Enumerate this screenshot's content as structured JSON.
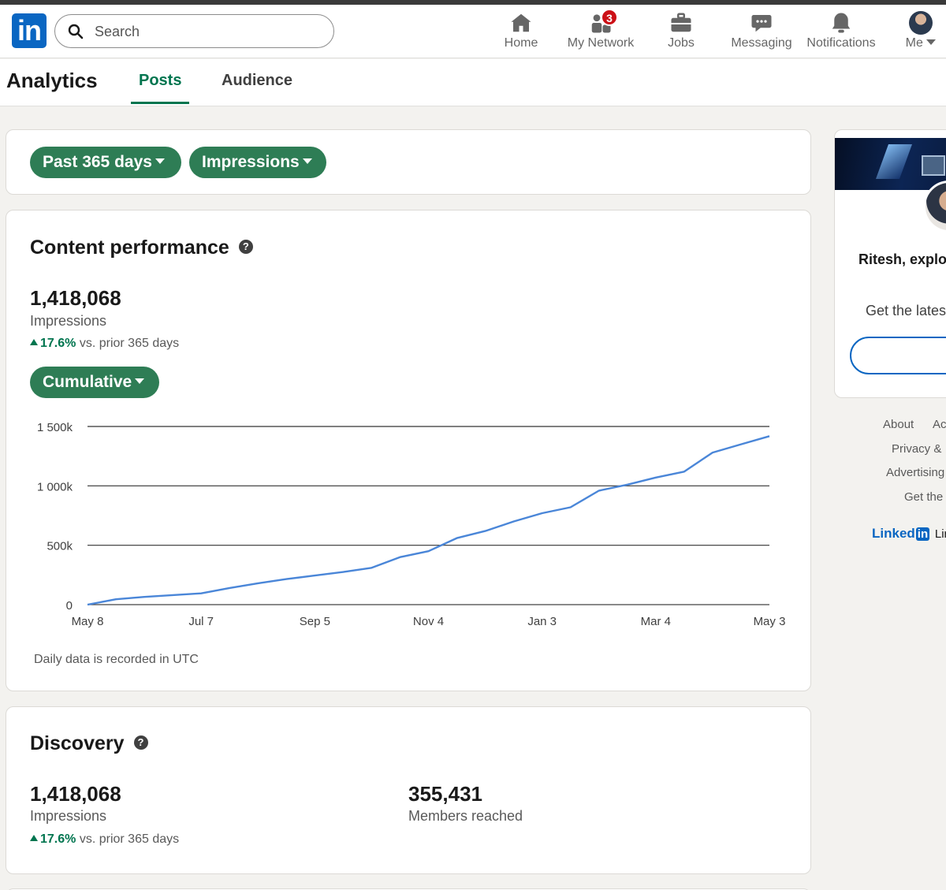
{
  "nav": {
    "logo_text": "in",
    "search_placeholder": "Search",
    "items": [
      {
        "label": "Home",
        "icon": "home-icon"
      },
      {
        "label": "My Network",
        "icon": "network-icon",
        "badge": "3"
      },
      {
        "label": "Jobs",
        "icon": "briefcase-icon"
      },
      {
        "label": "Messaging",
        "icon": "chat-icon"
      },
      {
        "label": "Notifications",
        "icon": "bell-icon"
      },
      {
        "label": "Me",
        "icon": "avatar"
      }
    ]
  },
  "subheader": {
    "title": "Analytics",
    "tabs": [
      {
        "label": "Posts",
        "active": true
      },
      {
        "label": "Audience",
        "active": false
      }
    ]
  },
  "filters": {
    "range_label": "Past 365 days",
    "metric_label": "Impressions"
  },
  "content_performance": {
    "title": "Content performance",
    "impressions_value": "1,418,068",
    "impressions_label": "Impressions",
    "trend_pct": "17.6%",
    "trend_text": "vs. prior 365 days",
    "mode_label": "Cumulative",
    "note": "Daily data is recorded in UTC"
  },
  "discovery": {
    "title": "Discovery",
    "impressions_value": "1,418,068",
    "impressions_label": "Impressions",
    "trend_pct": "17.6%",
    "trend_text": "vs. prior 365 days",
    "members_value": "355,431",
    "members_label": "Members reached"
  },
  "rail": {
    "name": "Ritesh, explo",
    "text": "Get the lates"
  },
  "footer": {
    "links": [
      "About",
      "Ac",
      "Privacy &",
      "Advertising",
      "Get the"
    ],
    "brand_word": "Linked",
    "brand_box": "in",
    "brand_tail": "Lir"
  },
  "colors": {
    "accent_green": "#2e7d55",
    "line_blue": "#4a86d8",
    "linkedin_blue": "#0a66c2",
    "badge_red": "#cc1016"
  },
  "chart_data": {
    "type": "line",
    "xlabel": "",
    "ylabel": "",
    "ylim": [
      0,
      1500000
    ],
    "y_ticks": [
      0,
      500000,
      1000000,
      1500000
    ],
    "y_tick_labels": [
      "0",
      "500k",
      "1 000k",
      "1 500k"
    ],
    "x_tick_labels": [
      "May 8",
      "Jul 7",
      "Sep 5",
      "Nov 4",
      "Jan 3",
      "Mar 4",
      "May 3"
    ],
    "grid": true,
    "series": [
      {
        "x": [
          "May 8",
          "May 23",
          "Jun 7",
          "Jun 22",
          "Jul 7",
          "Jul 22",
          "Aug 6",
          "Aug 21",
          "Sep 5",
          "Sep 20",
          "Oct 5",
          "Oct 20",
          "Nov 4",
          "Nov 19",
          "Dec 4",
          "Dec 19",
          "Jan 3",
          "Jan 18",
          "Feb 2",
          "Feb 17",
          "Mar 4",
          "Mar 19",
          "Apr 3",
          "Apr 18",
          "May 3"
        ],
        "values": [
          0,
          45000,
          65000,
          80000,
          95000,
          140000,
          180000,
          215000,
          245000,
          275000,
          310000,
          400000,
          450000,
          560000,
          620000,
          700000,
          770000,
          820000,
          960000,
          1010000,
          1070000,
          1120000,
          1280000,
          1350000,
          1418068
        ]
      }
    ]
  }
}
